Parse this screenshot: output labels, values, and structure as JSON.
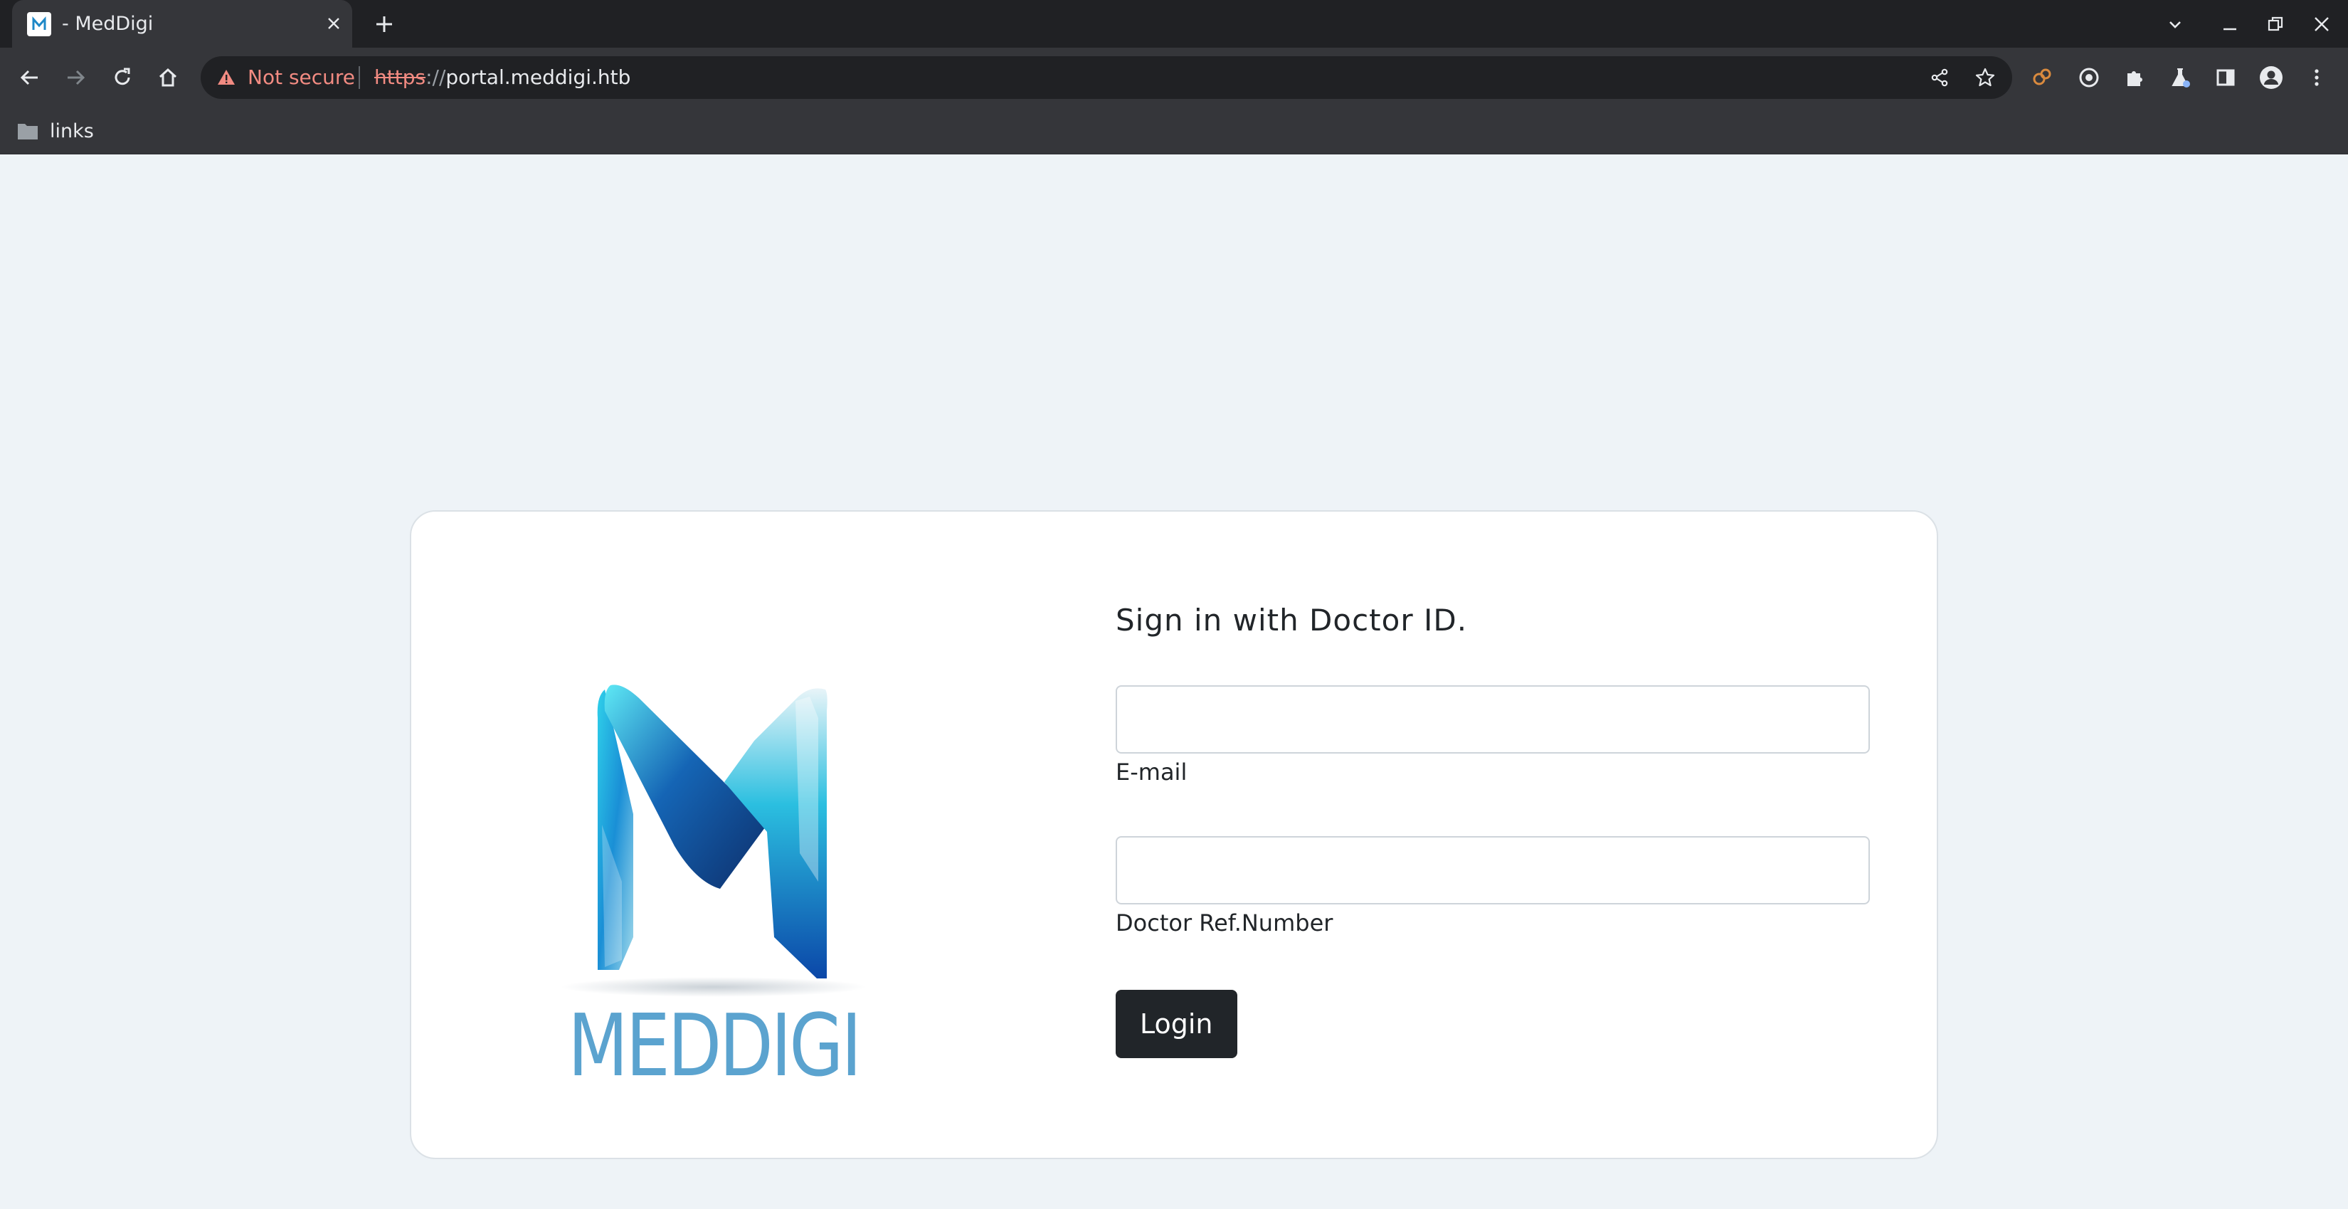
{
  "browser": {
    "tab": {
      "title": "- MedDigi"
    },
    "address": {
      "security_label": "Not secure",
      "url_scheme": "https",
      "url_separator": "://",
      "url_host": "portal.meddigi.htb"
    },
    "bookmarks": [
      {
        "label": "links",
        "icon": "folder-icon"
      }
    ]
  },
  "login": {
    "heading": "Sign in with Doctor ID.",
    "email_label": "E-mail",
    "email_value": "",
    "ref_label": "Doctor Ref.Number",
    "ref_value": "",
    "button_label": "Login",
    "logo_text": "MEDDIGI"
  },
  "colors": {
    "page_bg": "#eef3f7",
    "button_bg": "#212529",
    "logo_text": "#5ba3cf",
    "warning": "#f28b82"
  }
}
